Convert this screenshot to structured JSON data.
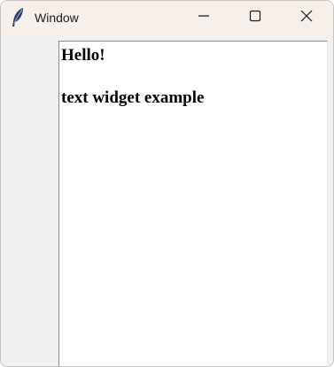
{
  "window": {
    "title": "Window",
    "controls": {
      "minimize_icon": "minimize-icon",
      "maximize_icon": "maximize-icon",
      "close_icon": "close-icon"
    }
  },
  "text_widget": {
    "lines": [
      "Hello!",
      "",
      "text widget example"
    ]
  }
}
